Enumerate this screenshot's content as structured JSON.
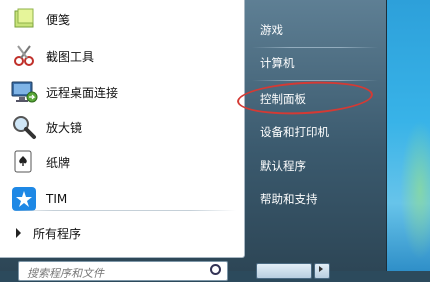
{
  "programs": [
    {
      "label": "便笺",
      "icon": "sticky-notes-icon"
    },
    {
      "label": "截图工具",
      "icon": "snipping-tool-icon"
    },
    {
      "label": "远程桌面连接",
      "icon": "remote-desktop-icon"
    },
    {
      "label": "放大镜",
      "icon": "magnifier-icon"
    },
    {
      "label": "纸牌",
      "icon": "solitaire-icon"
    },
    {
      "label": "TIM",
      "icon": "tim-icon"
    }
  ],
  "all_programs": "所有程序",
  "search": {
    "placeholder": "搜索程序和文件"
  },
  "right_items": [
    {
      "label": "游戏"
    },
    {
      "label": "计算机"
    },
    {
      "label": "控制面板"
    },
    {
      "label": "设备和打印机"
    },
    {
      "label": "默认程序"
    },
    {
      "label": "帮助和支持"
    }
  ],
  "colors": {
    "highlight_circle": "#d43a34",
    "menu_dark": "#3b5a6e"
  }
}
